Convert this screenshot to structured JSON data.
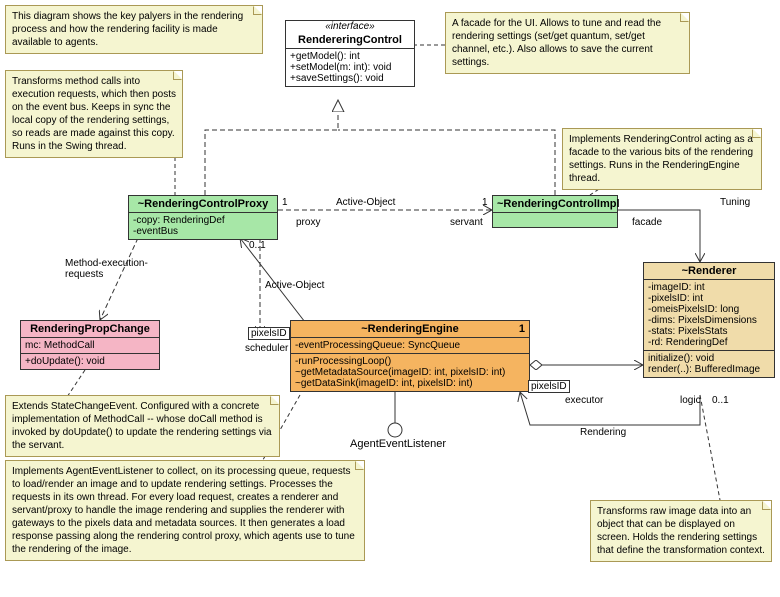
{
  "notes": {
    "top_overview": "This diagram shows the key palyers in the rendering process and how the rendering facility is made available to agents.",
    "facade_ui": "A facade for the UI.\nAllows to tune and read the rendering settings (set/get quantum, set/get channel, etc.).\nAlso allows to save the current settings.",
    "proxy_note": "Transforms method calls into execution requests, which then posts on the event bus.\nKeeps in sync the local copy of the rendering settings, so reads are made against this copy.\nRuns in the Swing thread.",
    "impl_note": "Implements RenderingControl acting as a facade to the various bits of the rendering settings.\nRuns in the RenderingEngine thread.",
    "propchange_note": "Extends StateChangeEvent. Configured with a concrete implementation of MethodCall -- whose doCall method is invoked by doUpdate() to update the rendering settings via the servant.",
    "engine_note": "Implements AgentEventListener to collect, on its processing queue, requests to load/render an image and to update rendering settings.\nProcesses the requests in its own thread.\nFor every load request, creates a renderer and servant/proxy to handle the image rendering and supplies the renderer with gateways to the pixels data and metadata sources. It then generates a load response passing along the rendering control proxy, which agents use to tune the rendering of the image.",
    "renderer_note": "Transforms raw image data into an object that can be displayed on screen.\nHolds the rendering settings that define the transformation context."
  },
  "classes": {
    "rendereringControl": {
      "stereotype": "«interface»",
      "name": "RendereringControl",
      "ops": [
        "+getModel(): int",
        "+setModel(m: int): void",
        "+saveSettings(): void"
      ]
    },
    "proxy": {
      "name": "~RenderingControlProxy",
      "attrs": [
        "-copy: RenderingDef",
        "-eventBus"
      ]
    },
    "impl": {
      "name": "~RenderingControlImpl"
    },
    "propChange": {
      "name": "RenderingPropChange",
      "attrs": [
        "mc: MethodCall"
      ],
      "ops": [
        "+doUpdate(): void"
      ]
    },
    "engine": {
      "name": "~RenderingEngine",
      "mult": "1",
      "attrs": [
        "-eventProcessingQueue: SyncQueue"
      ],
      "ops": [
        "-runProcessingLoop()",
        "~getMetadataSource(imageID: int, pixelsID: int)",
        "~getDataSink(imageID: int, pixelsID: int)"
      ]
    },
    "renderer": {
      "name": "~Renderer",
      "attrs": [
        "-imageID: int",
        "-pixelsID: int",
        "-omeisPixelsID: long",
        "-dims: PixelsDimensions",
        "-stats: PixelsStats",
        "-rd: RenderingDef"
      ],
      "ops": [
        "initialize(): void",
        "render(..): BufferedImage"
      ]
    },
    "agentListener": {
      "name": "AgentEventListener"
    }
  },
  "labels": {
    "activeObj1": "Active-Object",
    "activeObj2": "Active-Object",
    "tuning": "Tuning",
    "rendering": "Rendering",
    "methodExec": "Method-execution-\nrequests",
    "proxyRole": "proxy",
    "servantRole": "servant",
    "facadeRole": "facade",
    "schedulerRole": "scheduler",
    "executorRole": "executor",
    "logicRole": "logic",
    "mult1a": "1",
    "mult1b": "1",
    "mult01a": "0..1",
    "mult01b": "0..1",
    "pixelsID1": "pixelsID",
    "pixelsID2": "pixelsID"
  }
}
